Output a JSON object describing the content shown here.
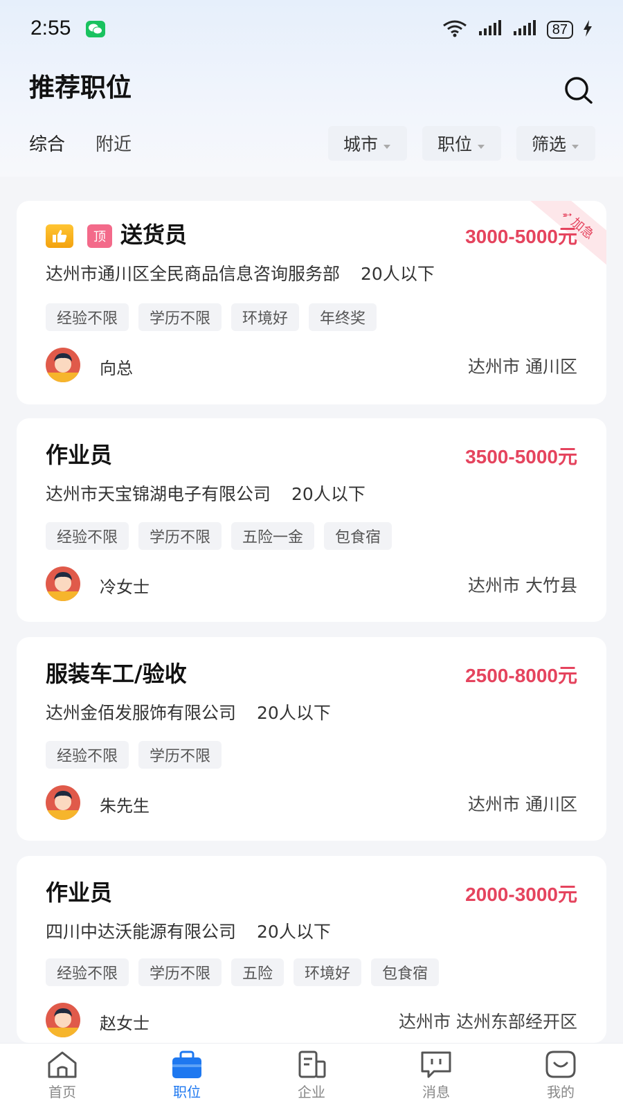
{
  "status_bar": {
    "time": "2:55",
    "network": "6",
    "battery": "87"
  },
  "header": {
    "title": "推荐职位",
    "search_icon": "search-icon"
  },
  "tabs": [
    {
      "label": "综合",
      "active": true
    },
    {
      "label": "附近",
      "active": false
    }
  ],
  "filters": [
    {
      "label": "城市"
    },
    {
      "label": "职位"
    },
    {
      "label": "筛选"
    }
  ],
  "jobs": [
    {
      "title": "送货员",
      "salary": "3000-5000元",
      "company": "达州市通川区全民商品信息咨询服务部",
      "size": "20人以下",
      "tags": [
        "经验不限",
        "学历不限",
        "环境好",
        "年终奖"
      ],
      "recruiter": "向总",
      "location": "达州市 通川区",
      "badges": {
        "top_label": "顶",
        "urgent_label": "加急"
      }
    },
    {
      "title": "作业员",
      "salary": "3500-5000元",
      "company": "达州市天宝锦湖电子有限公司",
      "size": "20人以下",
      "tags": [
        "经验不限",
        "学历不限",
        "五险一金",
        "包食宿"
      ],
      "recruiter": "冷女士",
      "location": "达州市 大竹县"
    },
    {
      "title": "服装车工/验收",
      "salary": "2500-8000元",
      "company": "达州金佰发服饰有限公司",
      "size": "20人以下",
      "tags": [
        "经验不限",
        "学历不限"
      ],
      "recruiter": "朱先生",
      "location": "达州市 通川区"
    },
    {
      "title": "作业员",
      "salary": "2000-3000元",
      "company": "四川中达沃能源有限公司",
      "size": "20人以下",
      "tags": [
        "经验不限",
        "学历不限",
        "五险",
        "环境好",
        "包食宿"
      ],
      "recruiter": "赵女士",
      "location": "达州市 达州东部经开区"
    }
  ],
  "bottom_nav": [
    {
      "label": "首页",
      "icon": "home-icon",
      "active": false
    },
    {
      "label": "职位",
      "icon": "briefcase-icon",
      "active": true
    },
    {
      "label": "企业",
      "icon": "building-icon",
      "active": false
    },
    {
      "label": "消息",
      "icon": "message-icon",
      "active": false
    },
    {
      "label": "我的",
      "icon": "profile-icon",
      "active": false
    }
  ],
  "colors": {
    "salary": "#e5445e",
    "active_nav": "#1e78f0"
  }
}
